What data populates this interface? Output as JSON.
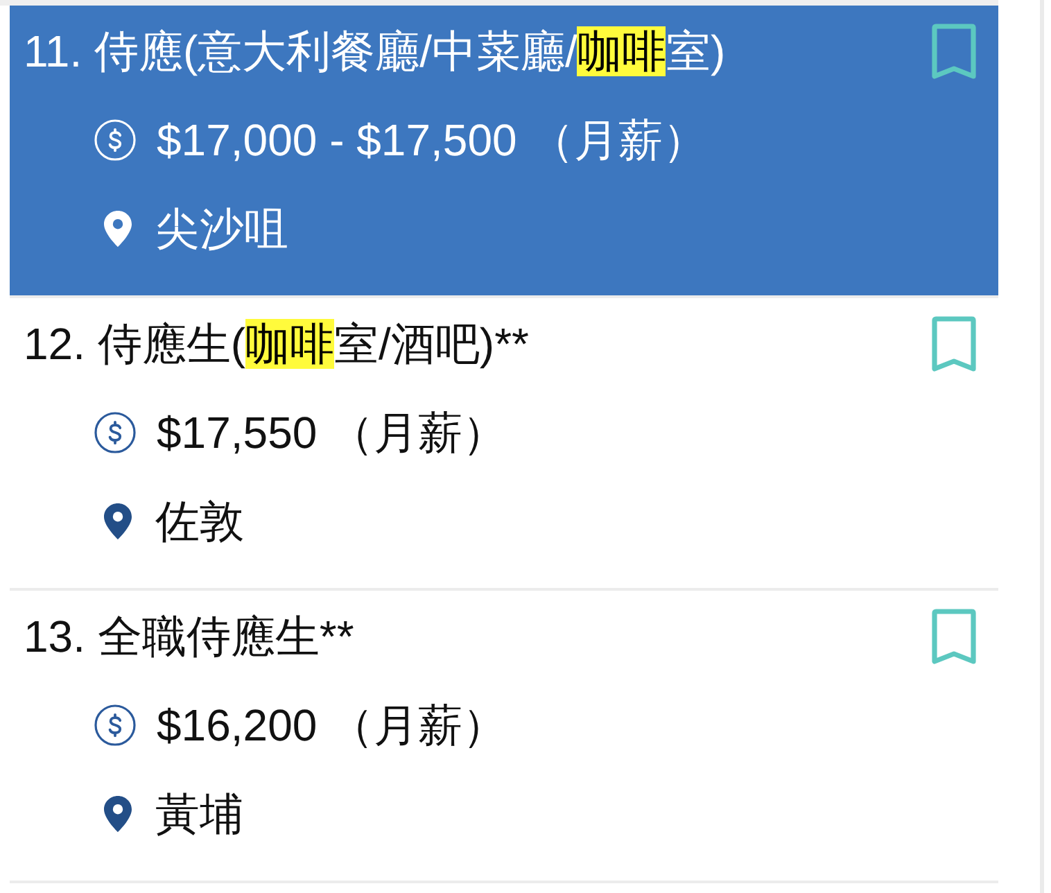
{
  "jobs": [
    {
      "selected": true,
      "saved": false,
      "title": [
        {
          "text": "11. 侍應(意大利餐廳/中菜廳/",
          "highlighted": false
        },
        {
          "text": "咖啡",
          "highlighted": true
        },
        {
          "text": "室)",
          "highlighted": false
        }
      ],
      "salary": "$17,000 - $17,500",
      "pay_period": "（月薪）",
      "location": "尖沙咀"
    },
    {
      "selected": false,
      "saved": false,
      "title": [
        {
          "text": "12. 侍應生(",
          "highlighted": false
        },
        {
          "text": "咖啡",
          "highlighted": true
        },
        {
          "text": "室/酒吧)**",
          "highlighted": false
        }
      ],
      "salary": "$17,550",
      "pay_period": "（月薪）",
      "location": "佐敦"
    },
    {
      "selected": false,
      "saved": false,
      "title": [
        {
          "text": "13. 全職侍應生**",
          "highlighted": false
        }
      ],
      "salary": "$16,200",
      "pay_period": "（月薪）",
      "location": "黃埔"
    }
  ]
}
